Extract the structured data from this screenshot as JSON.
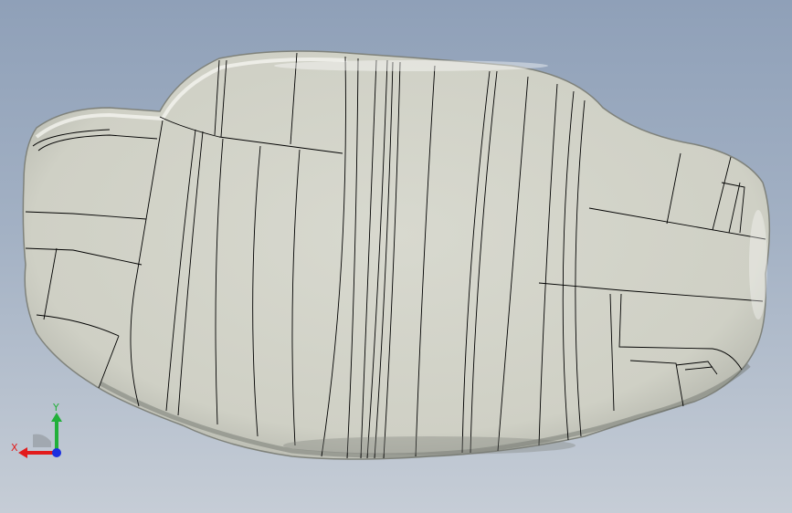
{
  "viewport": {
    "background_top": "#8fa0b8",
    "background_bottom": "#c6cdd6"
  },
  "model": {
    "face_color": "#d3d4c9",
    "edge_color": "#000000",
    "shadow_color": "#6e716b"
  },
  "triad": {
    "x_label": "X",
    "y_label": "Y",
    "x_color": "#e21b1b",
    "y_color": "#22b03a",
    "z_color": "#1a2fe0"
  }
}
